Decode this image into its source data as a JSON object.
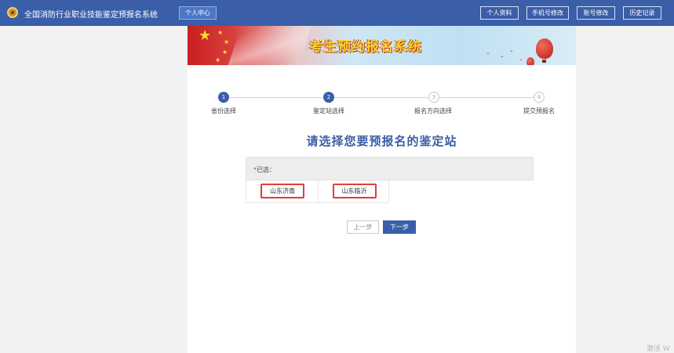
{
  "header": {
    "site_title": "全国消防行业职业技能鉴定预报名系统",
    "personal_center": "个人中心",
    "actions": [
      "个人资料",
      "手机号修改",
      "账号修改",
      "历史记录"
    ]
  },
  "banner": {
    "title": "考生预约报名系统"
  },
  "steps": [
    {
      "number": "1",
      "label": "省份选择",
      "state": "done"
    },
    {
      "number": "2",
      "label": "鉴定站选择",
      "state": "current"
    },
    {
      "number": "3",
      "label": "报名方向选择",
      "state": "todo"
    },
    {
      "number": "4",
      "label": "提交预报名",
      "state": "todo"
    }
  ],
  "main": {
    "heading": "请选择您要预报名的鉴定站",
    "selected_required_mark": "*",
    "selected_label": "已选：",
    "stations": [
      "山东济南",
      "山东临沂"
    ]
  },
  "buttons": {
    "prev": "上一步",
    "next": "下一步"
  },
  "watermark": "激活 W",
  "colors": {
    "primary": "#3a5ea8",
    "highlight_border": "#e23c3c",
    "page_bg": "#f2f2f2"
  }
}
